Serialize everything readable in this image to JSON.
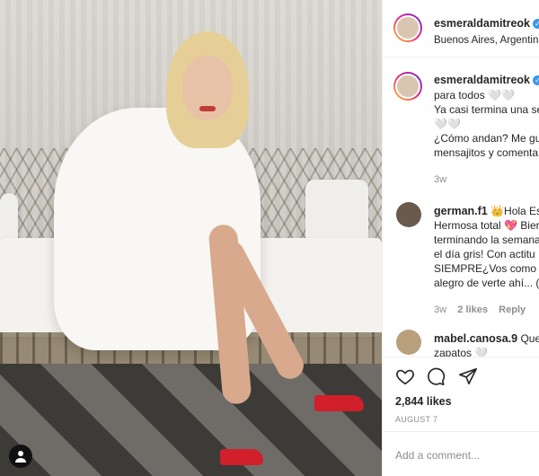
{
  "post": {
    "author": "esmeraldamitreok",
    "location": "Buenos Aires, Argentina",
    "caption_lines": [
      "para todos 🤍🤍",
      "Ya casi termina una se",
      "🤍🤍",
      "¿Cómo andan? Me gu",
      "mensajitos y comenta"
    ],
    "caption_age": "3w"
  },
  "comments": [
    {
      "user": "german.f1",
      "lines": [
        "👑Hola Esm",
        "Hermosa total 💖 Bier",
        "terminando la semana",
        "el día gris! Con actitu",
        "SIEMPRE¿Vos como a",
        "alegro de verte ahí... ("
      ],
      "age": "3w",
      "likes": "2 likes",
      "reply": "Reply"
    },
    {
      "user": "mabel.canosa.9",
      "lines": [
        "Que",
        "zapatos 🤍"
      ]
    }
  ],
  "likes_count": "2,844 likes",
  "date": "AUGUST 7",
  "add_comment_placeholder": "Add a comment...",
  "icons": {
    "like": "heart-icon",
    "comment": "comment-icon",
    "share": "send-icon",
    "verified": "verified-badge-icon",
    "user": "user-icon"
  },
  "colors": {
    "verified": "#3897f0",
    "muted": "#8e8e8e"
  }
}
